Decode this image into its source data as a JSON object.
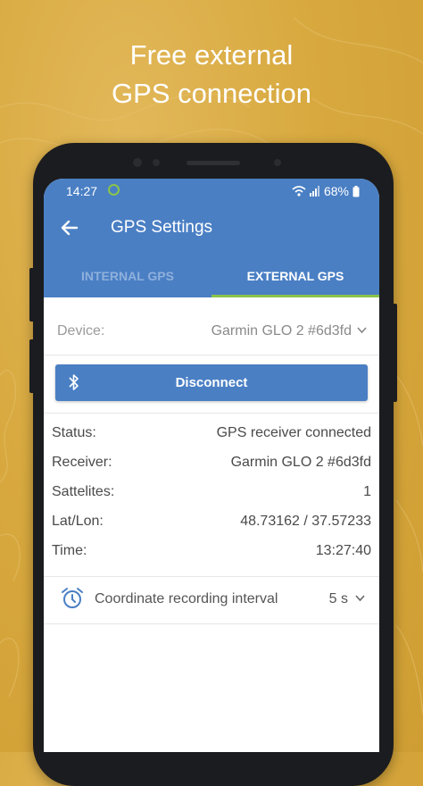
{
  "headline": {
    "line1": "Free external",
    "line2": "GPS connection"
  },
  "status_bar": {
    "time": "14:27",
    "battery": "68%"
  },
  "toolbar": {
    "title": "GPS Settings"
  },
  "tabs": [
    {
      "label": "INTERNAL GPS",
      "active": false
    },
    {
      "label": "EXTERNAL GPS",
      "active": true
    }
  ],
  "device": {
    "label": "Device:",
    "value": "Garmin GLO 2 #6d3fd"
  },
  "disconnect_button": {
    "label": "Disconnect"
  },
  "info": [
    {
      "key": "Status:",
      "value": "GPS receiver connected"
    },
    {
      "key": "Receiver:",
      "value": "Garmin GLO 2 #6d3fd"
    },
    {
      "key": "Sattelites:",
      "value": "1"
    },
    {
      "key": "Lat/Lon:",
      "value": "48.73162 / 37.57233"
    },
    {
      "key": "Time:",
      "value": "13:27:40"
    }
  ],
  "interval": {
    "label": "Coordinate recording interval",
    "value": "5 s"
  },
  "colors": {
    "background": "#d8a93f",
    "app_bar": "#4a7fc4",
    "tab_indicator": "#8bc34a",
    "phone_frame": "#1b1c1f"
  },
  "icons": [
    "back-arrow-icon",
    "bluetooth-icon",
    "alarm-clock-icon",
    "chevron-down-icon",
    "wifi-icon",
    "signal-icon",
    "battery-icon"
  ]
}
